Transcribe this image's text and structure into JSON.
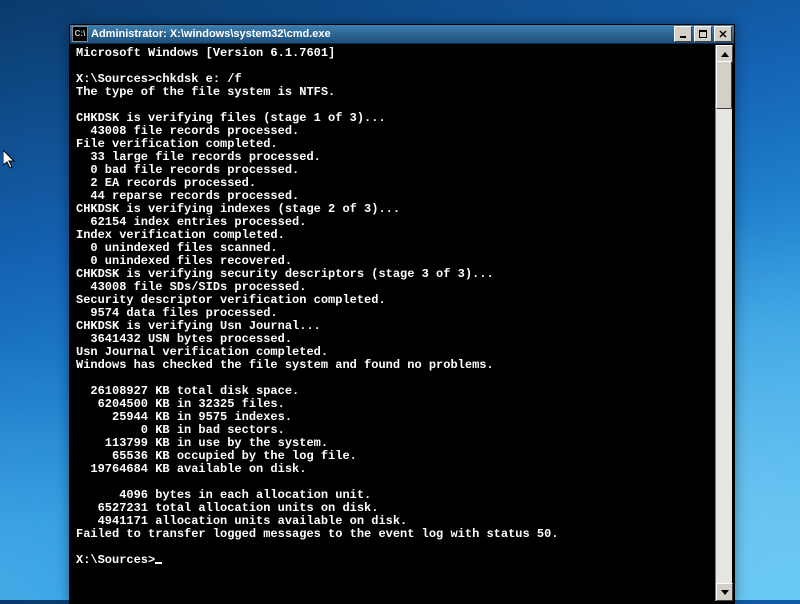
{
  "window": {
    "title": "Administrator: X:\\windows\\system32\\cmd.exe",
    "icon_label": "C:\\"
  },
  "console": {
    "header": "Microsoft Windows [Version 6.1.7601]",
    "prompt_path": "X:\\Sources>",
    "command": "chkdsk e: /f",
    "lines": [
      "The type of the file system is NTFS.",
      "",
      "CHKDSK is verifying files (stage 1 of 3)...",
      "  43008 file records processed.",
      "File verification completed.",
      "  33 large file records processed.",
      "  0 bad file records processed.",
      "  2 EA records processed.",
      "  44 reparse records processed.",
      "CHKDSK is verifying indexes (stage 2 of 3)...",
      "  62154 index entries processed.",
      "Index verification completed.",
      "  0 unindexed files scanned.",
      "  0 unindexed files recovered.",
      "CHKDSK is verifying security descriptors (stage 3 of 3)...",
      "  43008 file SDs/SIDs processed.",
      "Security descriptor verification completed.",
      "  9574 data files processed.",
      "CHKDSK is verifying Usn Journal...",
      "  3641432 USN bytes processed.",
      "Usn Journal verification completed.",
      "Windows has checked the file system and found no problems.",
      "",
      "  26108927 KB total disk space.",
      "   6204500 KB in 32325 files.",
      "     25944 KB in 9575 indexes.",
      "         0 KB in bad sectors.",
      "    113799 KB in use by the system.",
      "     65536 KB occupied by the log file.",
      "  19764684 KB available on disk.",
      "",
      "      4096 bytes in each allocation unit.",
      "   6527231 total allocation units on disk.",
      "   4941171 allocation units available on disk.",
      "Failed to transfer logged messages to the event log with status 50.",
      ""
    ],
    "final_prompt": "X:\\Sources>"
  }
}
